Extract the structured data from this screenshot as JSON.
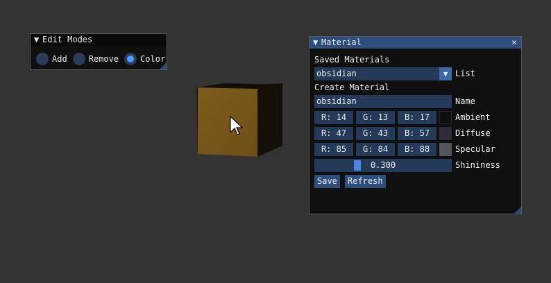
{
  "edit_modes": {
    "title": "Edit Modes",
    "options": [
      {
        "label": "Add",
        "selected": false
      },
      {
        "label": "Remove",
        "selected": false
      },
      {
        "label": "Color",
        "selected": true
      }
    ]
  },
  "material": {
    "title": "Material",
    "saved_header": "Saved Materials",
    "saved_value": "obsidian",
    "list_label": "List",
    "create_header": "Create Material",
    "name_value": "obsidian",
    "name_label": "Name",
    "ambient": {
      "r": "R: 14",
      "g": "G: 13",
      "b": "B: 17",
      "label": "Ambient",
      "color": "#0e0d11"
    },
    "diffuse": {
      "r": "R: 47",
      "g": "G: 43",
      "b": "B: 57",
      "label": "Diffuse",
      "color": "#2f2b39"
    },
    "specular": {
      "r": "R: 85",
      "g": "G: 84",
      "b": "B: 88",
      "label": "Specular",
      "color": "#555458"
    },
    "shininess": {
      "value": "0.300",
      "label": "Shininess"
    },
    "save_label": "Save",
    "refresh_label": "Refresh"
  },
  "colors": {
    "background": "#333333",
    "window_bg": "#0f0f0f",
    "title_active": "#2d4d7d",
    "frame_bg": "#253a58",
    "button": "#2e4e7c",
    "accent": "#4a9aff",
    "cube_front": "#7a5a1a",
    "cube_side": "#1a120a"
  }
}
